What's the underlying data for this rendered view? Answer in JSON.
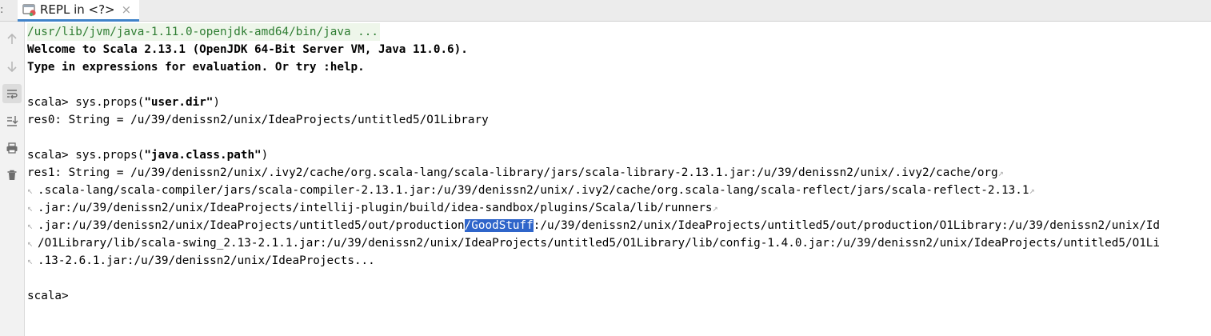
{
  "tab": {
    "label": "REPL in <?>",
    "close": "×",
    "left_mark": ":"
  },
  "toolbar": {
    "icons": [
      "arrow-up-icon",
      "arrow-down-icon",
      "soft-wrap-icon",
      "scroll-to-end-icon",
      "print-icon",
      "trash-icon"
    ]
  },
  "console": {
    "line0": "/usr/lib/jvm/java-1.11.0-openjdk-amd64/bin/java ...",
    "line1": "Welcome to Scala 2.13.1 (OpenJDK 64-Bit Server VM, Java 11.0.6).",
    "line2": "Type in expressions for evaluation. Or try :help.",
    "prompt1_prefix": "scala> sys.props(",
    "prompt1_arg": "\"user.dir\"",
    "prompt1_suffix": ")",
    "res0": "res0: String = /u/39/denissn2/unix/IdeaProjects/untitled5/O1Library",
    "prompt2_prefix": "scala> sys.props(",
    "prompt2_arg": "\"java.class.path\"",
    "prompt2_suffix": ")",
    "res1_l1": "res1: String = /u/39/denissn2/unix/.ivy2/cache/org.scala-lang/scala-library/jars/scala-library-2.13.1.jar:/u/39/denissn2/unix/.ivy2/cache/org",
    "res1_l2": ".scala-lang/scala-compiler/jars/scala-compiler-2.13.1.jar:/u/39/denissn2/unix/.ivy2/cache/org.scala-lang/scala-reflect/jars/scala-reflect-2.13.1",
    "res1_l3": ".jar:/u/39/denissn2/unix/IdeaProjects/intellij-plugin/build/idea-sandbox/plugins/Scala/lib/runners",
    "res1_l4_a": ".jar:/u/39/denissn2/unix/IdeaProjects/untitled5/out/production",
    "res1_l4_sel": "/GoodStuff",
    "res1_l4_b": ":/u/39/denissn2/unix/IdeaProjects/untitled5/out/production/O1Library:/u/39/denissn2/unix/Id",
    "res1_l5": "/O1Library/lib/scala-swing_2.13-2.1.1.jar:/u/39/denissn2/unix/IdeaProjects/untitled5/O1Library/lib/config-1.4.0.jar:/u/39/denissn2/unix/IdeaProjects/untitled5/O1Li",
    "res1_l6": ".13-2.6.1.jar:/u/39/denissn2/unix/IdeaProjects...",
    "final_prompt": "scala> "
  },
  "colors": {
    "selection": "#2f65ca",
    "tab_underline": "#4083c9",
    "path_green": "#2e7d32"
  }
}
